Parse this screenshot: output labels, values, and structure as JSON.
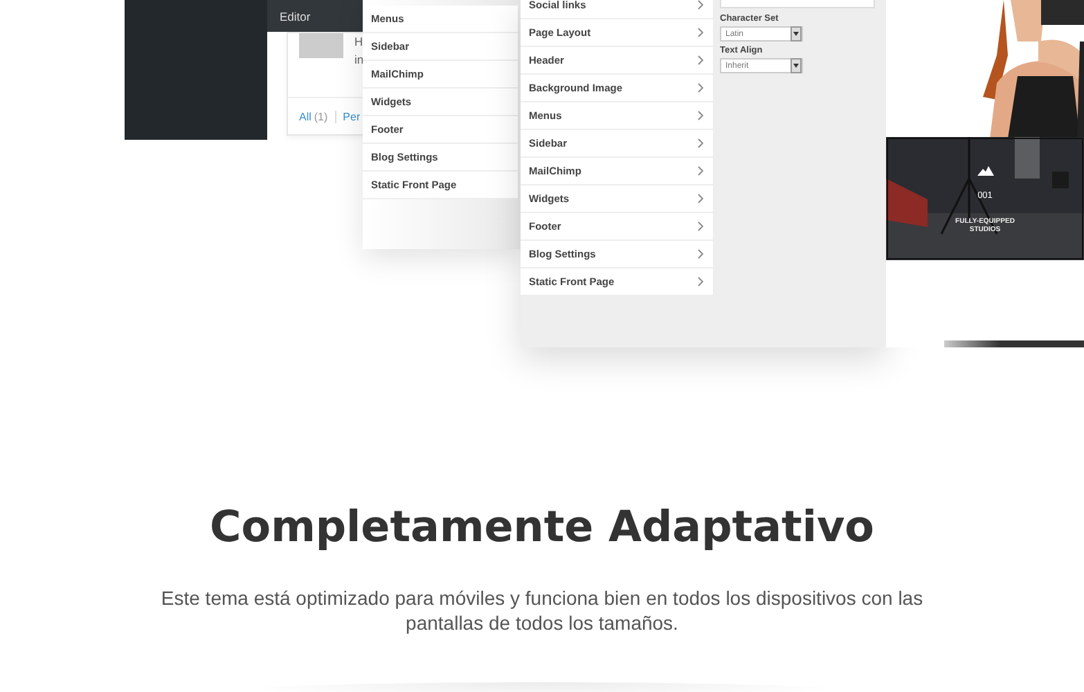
{
  "editor_panel": {
    "menu_item": "Editor"
  },
  "comments_card": {
    "text_lines": [
      "H",
      "in"
    ],
    "filters": [
      {
        "label": "All",
        "count": "(1)"
      },
      {
        "label": "Per"
      }
    ]
  },
  "back_customizer": {
    "sections": [
      "Menus",
      "Sidebar",
      "MailChimp",
      "Widgets",
      "Footer",
      "Blog Settings",
      "Static Front Page"
    ]
  },
  "front_customizer": {
    "sections": [
      "Social links",
      "Page Layout",
      "Header",
      "Background Image",
      "Menus",
      "Sidebar",
      "MailChimp",
      "Widgets",
      "Footer",
      "Blog Settings",
      "Static Front Page"
    ],
    "fields": [
      {
        "label": "Character Set",
        "value": "Latin"
      },
      {
        "label": "Text Align",
        "value": "Inherit"
      }
    ]
  },
  "preview": {
    "number": "001",
    "caption": "FULLY-EQUIPPED STUDIOS"
  },
  "heading": "Completamente Adaptativo",
  "description": "Este tema está optimizado para móviles y funciona bien en todos los dispositivos con las pantallas de todos los tamaños."
}
